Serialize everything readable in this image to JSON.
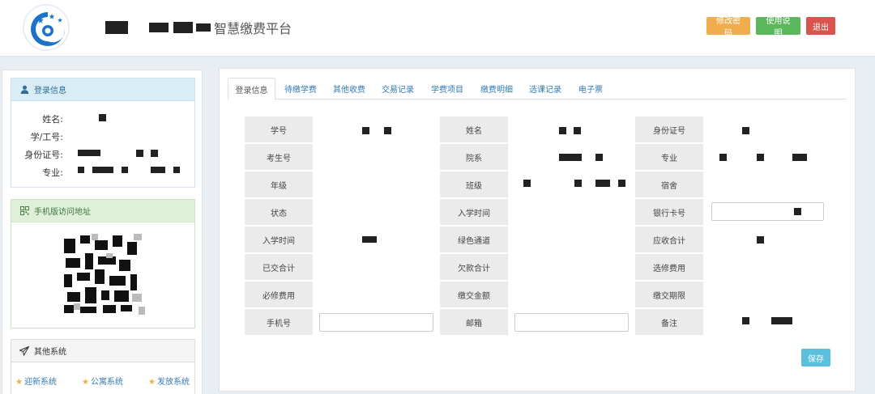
{
  "header": {
    "site_name": "智慧缴费平台",
    "buttons": {
      "change_password": "修改密码",
      "user_guide": "使用说明",
      "logout": "退出"
    },
    "colors": {
      "warning": "#f0ad4e",
      "success": "#5cb85c",
      "danger": "#d9534f"
    }
  },
  "sidebar": {
    "login_panel": {
      "title": "登录信息",
      "icon": "user-icon",
      "fields": [
        {
          "label": "姓名:"
        },
        {
          "label": "学/工号:"
        },
        {
          "label": "身份证号:"
        },
        {
          "label": "专业:"
        }
      ]
    },
    "mobile_panel": {
      "title": "手机版访问地址",
      "icon": "qrcode-icon"
    },
    "other_panel": {
      "title": "其他系统",
      "icon": "paper-plane-icon",
      "links": [
        "迎新系统",
        "公寓系统",
        "发放系统"
      ]
    }
  },
  "main": {
    "tabs": [
      "登录信息",
      "待缴学费",
      "其他收费",
      "交易记录",
      "学费项目",
      "缴费明细",
      "选课记录",
      "电子票"
    ],
    "active_tab": 0,
    "grid": [
      [
        "学号",
        "姓名",
        "身份证号"
      ],
      [
        "考生号",
        "院系",
        "专业"
      ],
      [
        "年级",
        "班级",
        "宿舍"
      ],
      [
        "状态",
        "入学时间",
        "银行卡号"
      ],
      [
        "入学时间",
        "绿色通道",
        "应收合计"
      ],
      [
        "已交合计",
        "欠款合计",
        "选修费用"
      ],
      [
        "必修费用",
        "缴交金额",
        "缴交期限"
      ],
      [
        "手机号",
        "邮箱",
        "备注"
      ]
    ],
    "save_label": "保存"
  }
}
